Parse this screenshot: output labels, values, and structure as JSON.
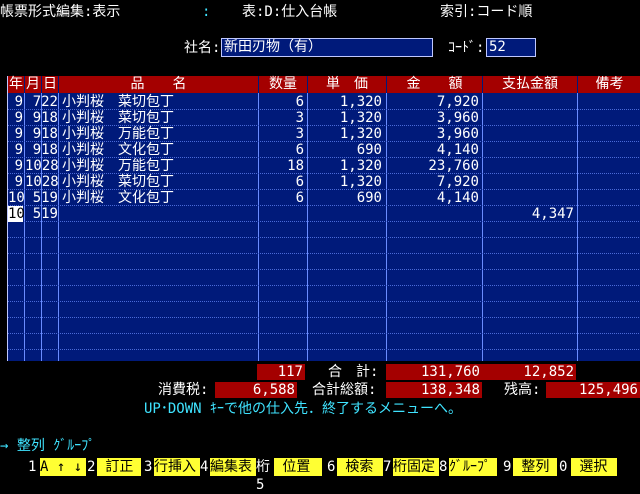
{
  "header": {
    "form_edit": "帳票形式編集:表示",
    "colon": ":",
    "table": "表:D:仕入台帳",
    "index": "索引:コード順"
  },
  "company": {
    "label": "社名:",
    "value": "新田刃物（有）",
    "code_label": "ｺｰﾄﾞ:",
    "code_value": "52"
  },
  "columns": [
    "年",
    "月",
    "日",
    "品　　名",
    "数量",
    "単　価",
    "金　　額",
    "支払金額",
    "備考"
  ],
  "rows": [
    {
      "y": "9",
      "md": "722",
      "item": "小判桜　菜切包丁",
      "qty": "6",
      "price": "1,320",
      "amount": "7,920",
      "paid": ""
    },
    {
      "y": "9",
      "md": "918",
      "item": "小判桜　菜切包丁",
      "qty": "3",
      "price": "1,320",
      "amount": "3,960",
      "paid": ""
    },
    {
      "y": "9",
      "md": "918",
      "item": "小判桜　万能包丁",
      "qty": "3",
      "price": "1,320",
      "amount": "3,960",
      "paid": ""
    },
    {
      "y": "9",
      "md": "918",
      "item": "小判桜　文化包丁",
      "qty": "6",
      "price": "690",
      "amount": "4,140",
      "paid": ""
    },
    {
      "y": "9",
      "md": "1028",
      "item": "小判桜　万能包丁",
      "qty": "18",
      "price": "1,320",
      "amount": "23,760",
      "paid": ""
    },
    {
      "y": "9",
      "md": "1028",
      "item": "小判桜　菜切包丁",
      "qty": "6",
      "price": "1,320",
      "amount": "7,920",
      "paid": ""
    },
    {
      "y": "10",
      "md": "519",
      "item": "小判桜　文化包丁",
      "qty": "6",
      "price": "690",
      "amount": "4,140",
      "paid": ""
    },
    {
      "y": "10",
      "md": "519",
      "item": "",
      "qty": "",
      "price": "",
      "amount": "",
      "paid": "4,347"
    }
  ],
  "totals": {
    "qty": "117",
    "total_label": "合　計:",
    "amount": "131,760",
    "paid": "12,852",
    "tax_label": "消費税:",
    "tax": "6,588",
    "grand_label": "合計総額:",
    "grand": "138,348",
    "balance_label": "残高:",
    "balance": "125,496"
  },
  "message": "UP･DOWN ｷｰで他の仕入先．終了するメニューへ。",
  "mode_line": "→ 整列 ｸﾞﾙｰﾌﾟ",
  "fkeys": [
    {
      "num": "1",
      "label": "A ↑ ↓"
    },
    {
      "num": "2",
      "label": " 訂正 "
    },
    {
      "num": "3",
      "label": "行挿入"
    },
    {
      "num": "4",
      "label": "編集表"
    },
    {
      "num": "桁5",
      "label": " 位置 "
    },
    {
      "num": "6",
      "label": " 検索 "
    },
    {
      "num": "7",
      "label": "桁固定"
    },
    {
      "num": "8",
      "label": "ｸﾞﾙｰﾌﾟ"
    },
    {
      "num": "9",
      "label": " 整列 "
    },
    {
      "num": "0",
      "label": " 選択 "
    }
  ],
  "colors": {
    "background": "#000000",
    "grid": "#001a7a",
    "header_red": "#a40000",
    "accent_cyan": "#3fe3ff",
    "fkey_yellow": "#ffff33"
  }
}
